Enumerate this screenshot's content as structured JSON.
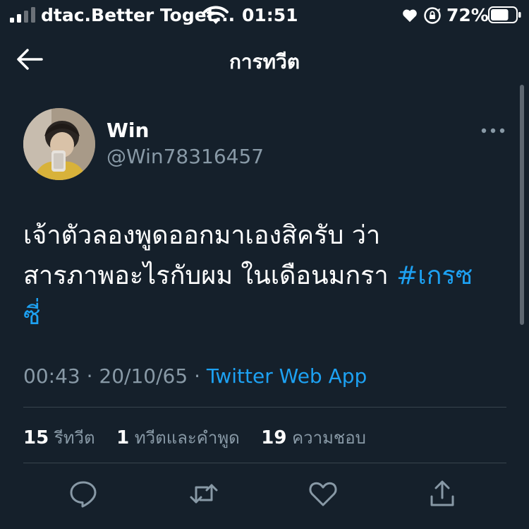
{
  "status_bar": {
    "carrier": "dtac.Better Toget...",
    "time": "01:51",
    "battery_percent": "72%",
    "battery_level": 0.72
  },
  "header": {
    "title": "การทวีต",
    "back_icon": "arrow-left-icon"
  },
  "tweet": {
    "author_name": "Win",
    "author_handle": "@Win78316457",
    "text_line1": "เจ้าตัวลองพูดออกมาเองสิครับ ว่า",
    "text_line2_prefix": "สารภาพอะไรกับผม ในเดือนมกรา ",
    "hashtag_part1": "#เกรซ",
    "hashtag_part2": "ซี่",
    "time": "00:43",
    "date": "20/10/65",
    "source": "Twitter Web App",
    "separator": "·"
  },
  "stats": {
    "retweets_count": "15",
    "retweets_label": "รีทวีต",
    "quotes_count": "1",
    "quotes_label": "ทวีตและคำพูด",
    "likes_count": "19",
    "likes_label": "ความชอบ"
  },
  "actions": {
    "reply_icon": "reply-icon",
    "retweet_icon": "retweet-icon",
    "like_icon": "heart-icon",
    "share_icon": "share-icon"
  },
  "colors": {
    "background": "#15202b",
    "accent": "#1da1f2",
    "secondary_text": "#8899a6",
    "divider": "#38444d"
  }
}
